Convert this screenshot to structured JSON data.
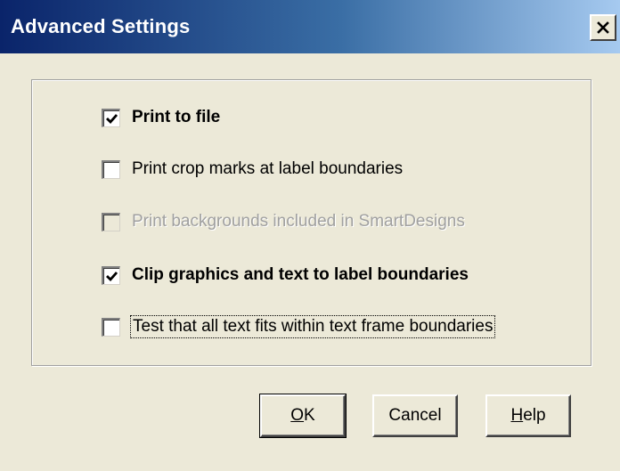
{
  "window": {
    "title": "Advanced Settings"
  },
  "options": [
    {
      "label": "Print to file",
      "checked": true,
      "bold": true,
      "disabled": false,
      "focused": false
    },
    {
      "label": "Print crop marks at label boundaries",
      "checked": false,
      "bold": false,
      "disabled": false,
      "focused": false
    },
    {
      "label": "Print backgrounds included in SmartDesigns",
      "checked": false,
      "bold": false,
      "disabled": true,
      "focused": false
    },
    {
      "label": "Clip graphics and text to label boundaries",
      "checked": true,
      "bold": true,
      "disabled": false,
      "focused": false
    },
    {
      "label": "Test that all text fits within text frame boundaries",
      "checked": false,
      "bold": false,
      "disabled": false,
      "focused": true
    }
  ],
  "buttons": {
    "ok": {
      "mnemonic": "O",
      "rest": "K"
    },
    "cancel": {
      "label": "Cancel"
    },
    "help": {
      "mnemonic": "H",
      "rest": "elp"
    }
  },
  "icons": {
    "close": "close-icon",
    "check": "checkmark-icon"
  },
  "colors": {
    "titlebar_start": "#0a246a",
    "titlebar_end": "#a6caf0",
    "face": "#ece9d8"
  }
}
